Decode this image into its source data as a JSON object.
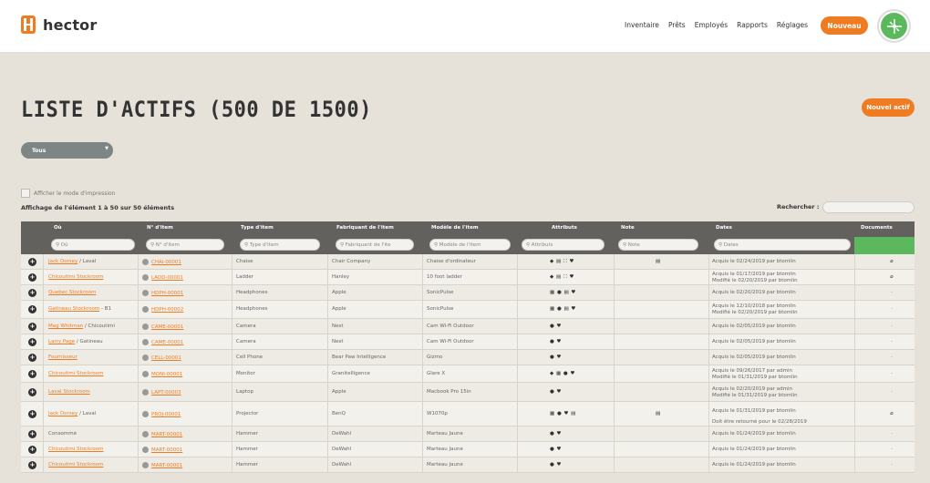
{
  "brand": {
    "name": "hector"
  },
  "nav": {
    "items": [
      "Inventaire",
      "Prêts",
      "Employés",
      "Rapports",
      "Réglages"
    ],
    "new_button": "Nouveau"
  },
  "page": {
    "title": "LISTE D'ACTIFS (500 DE 1500)",
    "new_asset_button": "Nouvel actif",
    "filter_value": "Tous",
    "print_mode_label": "Afficher le mode d'impression",
    "showing_text": "Affichage de l'élément 1 à 50 sur 50 éléments",
    "search_label": "Rechercher :"
  },
  "table": {
    "headers": [
      "Où",
      "N° d'item",
      "Type d'item",
      "Fabriquant de l'item",
      "Modèle de l'item",
      "Attributs",
      "Note",
      "Dates",
      "Documents"
    ],
    "filter_placeholders": [
      "Où",
      "N° d'item",
      "Type d'item",
      "Fabriquant de l'ite",
      "Modèle de l'item",
      "Attributs",
      "Note",
      "Dates"
    ],
    "rows": [
      {
        "where_link": "Jack Dorsey",
        "where_rest": " / Laval",
        "item_no": "CHAI-00001",
        "type": "Chaise",
        "maker": "Chair Company",
        "model": "Chaise d'ordinateur",
        "attrs": "◆ ▤ ⛶ ♥",
        "note": "▤",
        "dates": [
          "Acquis le 02/24/2019 par btomlin"
        ],
        "doc": "⌀"
      },
      {
        "where_link": "Chicoutimi Stockroom",
        "where_rest": "",
        "item_no": "LADD-00001",
        "type": "Ladder",
        "maker": "Hanley",
        "model": "10 foot ladder",
        "attrs": "◆ ▤ ⛶ ♥",
        "note": "",
        "dates": [
          "Acquis le 01/17/2019 par btomlin",
          "Modifié le 02/20/2019 par btomlin"
        ],
        "doc": "⌀"
      },
      {
        "where_link": "Quebec Stockroom",
        "where_rest": "",
        "item_no": "HDPH-00001",
        "type": "Headphones",
        "maker": "Apple",
        "model": "SonicPulse",
        "attrs": "▦ ● ▤ ♥",
        "note": "",
        "dates": [
          "Acquis le 02/20/2019 par btomlin"
        ],
        "doc": "-"
      },
      {
        "where_link": "Gatineau Stockroom",
        "where_rest": " - B1",
        "item_no": "HDPH-00002",
        "type": "Headphones",
        "maker": "Apple",
        "model": "SonicPulse",
        "attrs": "▦ ● ▤ ♥",
        "note": "",
        "dates": [
          "Acquis le 12/10/2018 par btomlin",
          "Modifié le 02/20/2019 par btomlin"
        ],
        "doc": "-"
      },
      {
        "where_link": "Meg Whitman",
        "where_rest": " / Chicoutimi",
        "item_no": "CAME-00001",
        "type": "Camera",
        "maker": "Nest",
        "model": "Cam Wi-Fi Outdoor",
        "attrs": "● ♥",
        "note": "",
        "dates": [
          "Acquis le 02/05/2019 par btomlin"
        ],
        "doc": "-"
      },
      {
        "where_link": "Larry Page",
        "where_rest": " / Gatineau",
        "item_no": "CAME-00001",
        "type": "Camera",
        "maker": "Nest",
        "model": "Cam Wi-Fi Outdoor",
        "attrs": "● ♥",
        "note": "",
        "dates": [
          "Acquis le 02/05/2019 par btomlin"
        ],
        "doc": "-"
      },
      {
        "where_link": "Fournisseur",
        "where_rest": "",
        "item_no": "CELL-00001",
        "type": "Cell Phone",
        "maker": "Bear Paw Intelligence",
        "model": "Gizmo",
        "attrs": "● ♥",
        "note": "",
        "dates": [
          "Acquis le 02/05/2019 par btomlin"
        ],
        "doc": "-"
      },
      {
        "where_link": "Chicoutimi Stockroom",
        "where_rest": "",
        "item_no": "MONI-00001",
        "type": "Monitor",
        "maker": "GraniteIligence",
        "model": "Glare X",
        "attrs": "◆ ▦ ● ♥",
        "note": "",
        "dates": [
          "Acquis le 09/26/2017 par admin",
          "Modifié le 01/31/2019 par btomlin"
        ],
        "doc": "-"
      },
      {
        "where_link": "Laval Stockroom",
        "where_rest": "",
        "item_no": "LAPT-00003",
        "type": "Laptop",
        "maker": "Apple",
        "model": "Macbook Pro 15in",
        "attrs": "● ♥",
        "note": "",
        "dates": [
          "Acquis le 02/20/2019 par admin",
          "Modifié le 01/31/2019 par btomlin"
        ],
        "doc": "-"
      },
      {
        "where_link": "Jack Dorsey",
        "where_rest": " / Laval",
        "item_no": "PROJ-00001",
        "type": "Projector",
        "maker": "BenQ",
        "model": "W1070p",
        "attrs": "▦ ● ♥ ▤",
        "note": "▤",
        "dates": [
          "Acquis le 01/31/2019 par btomlin",
          "Doit être retourné pour le 02/28/2019"
        ],
        "doc": "⌀"
      },
      {
        "where_link": "",
        "where_rest": "Consommé",
        "item_no": "MART-00001",
        "type": "Hammer",
        "maker": "DeWahl",
        "model": "Marteau Jaune",
        "attrs": "● ♥",
        "note": "",
        "dates": [
          "Acquis le 01/24/2019 par btomlin"
        ],
        "doc": "-"
      },
      {
        "where_link": "Chicoutimi Stockroom",
        "where_rest": "",
        "item_no": "MART-00001",
        "type": "Hammer",
        "maker": "DeWahl",
        "model": "Marteau Jaune",
        "attrs": "● ♥",
        "note": "",
        "dates": [
          "Acquis le 01/24/2019 par btomlin"
        ],
        "doc": "-"
      },
      {
        "where_link": "Chicoutimi Stockroom",
        "where_rest": "",
        "item_no": "MART-00001",
        "type": "Hammer",
        "maker": "DeWahl",
        "model": "Marteau Jaune",
        "attrs": "● ♥",
        "note": "",
        "dates": [
          "Acquis le 01/24/2019 par btomlin"
        ],
        "doc": "-"
      }
    ]
  },
  "colors": {
    "accent": "#f07c22",
    "header": "#62615d",
    "documents": "#5cb85c"
  }
}
